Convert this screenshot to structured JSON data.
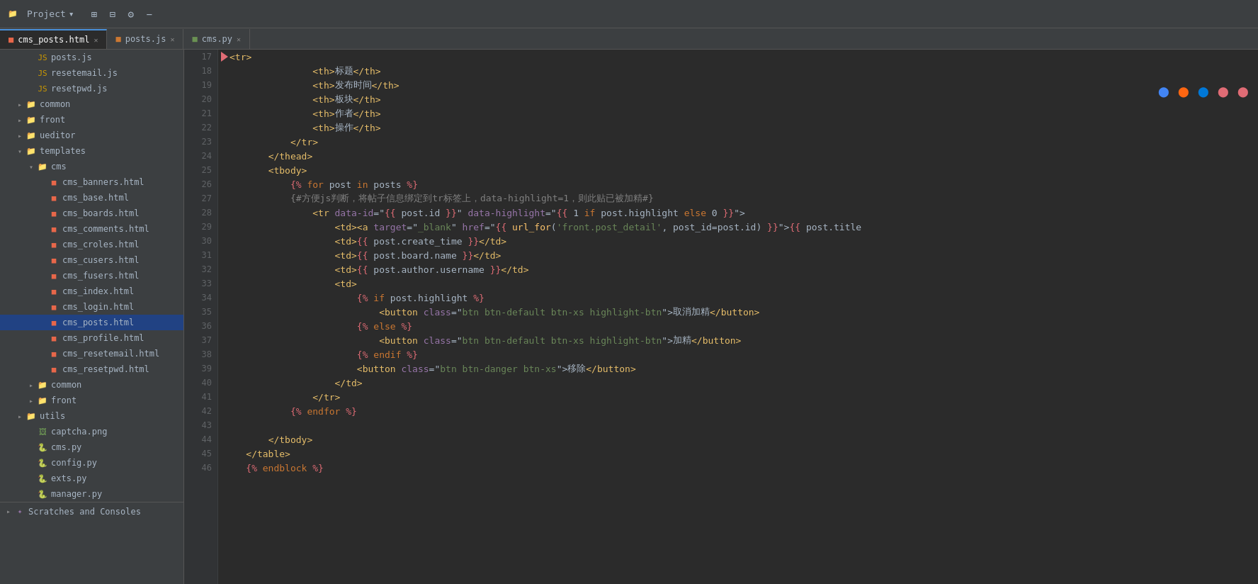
{
  "titleBar": {
    "projectLabel": "Project",
    "icons": [
      "settings-icon",
      "layout-icon",
      "gear-icon",
      "minus-icon"
    ]
  },
  "tabs": [
    {
      "id": "cms_posts",
      "label": "cms_posts.html",
      "type": "html",
      "active": true
    },
    {
      "id": "posts_js",
      "label": "posts.js",
      "type": "js",
      "active": false
    },
    {
      "id": "cms_py",
      "label": "cms.py",
      "type": "py",
      "active": false
    }
  ],
  "sidebar": {
    "files": [
      {
        "id": "posts_js_file",
        "label": "posts.js",
        "type": "js",
        "indent": 2
      },
      {
        "id": "resetemail_js",
        "label": "resetemail.js",
        "type": "js",
        "indent": 2
      },
      {
        "id": "resetpwd_js",
        "label": "resetpwd.js",
        "type": "js",
        "indent": 2
      },
      {
        "id": "common_folder",
        "label": "common",
        "type": "folder",
        "indent": 1,
        "open": false
      },
      {
        "id": "front_folder",
        "label": "front",
        "type": "folder",
        "indent": 1,
        "open": false
      },
      {
        "id": "ueditor_folder",
        "label": "ueditor",
        "type": "folder",
        "indent": 1,
        "open": false
      },
      {
        "id": "templates_folder",
        "label": "templates",
        "type": "folder",
        "indent": 1,
        "open": true
      },
      {
        "id": "cms_folder",
        "label": "cms",
        "type": "folder",
        "indent": 2,
        "open": true
      },
      {
        "id": "cms_banners",
        "label": "cms_banners.html",
        "type": "html",
        "indent": 3
      },
      {
        "id": "cms_base",
        "label": "cms_base.html",
        "type": "html",
        "indent": 3
      },
      {
        "id": "cms_boards",
        "label": "cms_boards.html",
        "type": "html",
        "indent": 3
      },
      {
        "id": "cms_comments",
        "label": "cms_comments.html",
        "type": "html",
        "indent": 3
      },
      {
        "id": "cms_croles",
        "label": "cms_croles.html",
        "type": "html",
        "indent": 3
      },
      {
        "id": "cms_cusers",
        "label": "cms_cusers.html",
        "type": "html",
        "indent": 3
      },
      {
        "id": "cms_fusers",
        "label": "cms_fusers.html",
        "type": "html",
        "indent": 3
      },
      {
        "id": "cms_index",
        "label": "cms_index.html",
        "type": "html",
        "indent": 3
      },
      {
        "id": "cms_login",
        "label": "cms_login.html",
        "type": "html",
        "indent": 3
      },
      {
        "id": "cms_posts_html",
        "label": "cms_posts.html",
        "type": "html",
        "indent": 3,
        "selected": true
      },
      {
        "id": "cms_profile",
        "label": "cms_profile.html",
        "type": "html",
        "indent": 3
      },
      {
        "id": "cms_resetemail",
        "label": "cms_resetemail.html",
        "type": "html",
        "indent": 3
      },
      {
        "id": "cms_resetpwd",
        "label": "cms_resetpwd.html",
        "type": "html",
        "indent": 3
      },
      {
        "id": "common_folder2",
        "label": "common",
        "type": "folder",
        "indent": 2,
        "open": false
      },
      {
        "id": "front_folder2",
        "label": "front",
        "type": "folder",
        "indent": 2,
        "open": false
      },
      {
        "id": "utils_folder",
        "label": "utils",
        "type": "folder",
        "indent": 1,
        "open": false
      },
      {
        "id": "captcha_png",
        "label": "captcha.png",
        "type": "png",
        "indent": 2
      },
      {
        "id": "cms_py_file",
        "label": "cms.py",
        "type": "py",
        "indent": 2
      },
      {
        "id": "config_py",
        "label": "config.py",
        "type": "py",
        "indent": 2
      },
      {
        "id": "exts_py",
        "label": "exts.py",
        "type": "py",
        "indent": 2
      },
      {
        "id": "manager_py",
        "label": "manager.py",
        "type": "py",
        "indent": 2
      }
    ],
    "scratchesLabel": "Scratches and Consoles"
  },
  "editor": {
    "filename": "cms_posts.html",
    "lines": [
      {
        "num": 17,
        "content": "            <tr>"
      },
      {
        "num": 18,
        "content": "                <th>标题</th>"
      },
      {
        "num": 19,
        "content": "                <th>发布时间</th>"
      },
      {
        "num": 20,
        "content": "                <th>板块</th>"
      },
      {
        "num": 21,
        "content": "                <th>作者</th>"
      },
      {
        "num": 22,
        "content": "                <th>操作</th>"
      },
      {
        "num": 23,
        "content": "            </tr>"
      },
      {
        "num": 24,
        "content": "        </thead>"
      },
      {
        "num": 25,
        "content": "        <tbody>"
      },
      {
        "num": 26,
        "content": "            {% for post in posts %}"
      },
      {
        "num": 27,
        "content": "            {#方便js判断，将帖子信息绑定到tr标签上，data-highlight=1，则此贴已被加精#}"
      },
      {
        "num": 28,
        "content": "                <tr data-id=\"{{ post.id }}\" data-highlight=\"{{ 1 if post.highlight else 0 }}\">"
      },
      {
        "num": 29,
        "content": "                    <td><a target=\"_blank\" href=\"{{ url_for('front.post_detail', post_id=post.id) }}\">{{ post.title"
      },
      {
        "num": 30,
        "content": "                    <td>{{ post.create_time }}</td>"
      },
      {
        "num": 31,
        "content": "                    <td>{{ post.board.name }}</td>"
      },
      {
        "num": 32,
        "content": "                    <td>{{ post.author.username }}</td>"
      },
      {
        "num": 33,
        "content": "                    <td>"
      },
      {
        "num": 34,
        "content": "                        {% if post.highlight %}"
      },
      {
        "num": 35,
        "content": "                            <button class=\"btn btn-default btn-xs highlight-btn\">取消加精</button>"
      },
      {
        "num": 36,
        "content": "                        {% else %}"
      },
      {
        "num": 37,
        "content": "                            <button class=\"btn btn-default btn-xs highlight-btn\">加精</button>"
      },
      {
        "num": 38,
        "content": "                        {% endif %}"
      },
      {
        "num": 39,
        "content": "                        <button class=\"btn btn-danger btn-xs\">移除</button>"
      },
      {
        "num": 40,
        "content": "                    </td>"
      },
      {
        "num": 41,
        "content": "                </tr>"
      },
      {
        "num": 42,
        "content": "            {% endfor %}"
      },
      {
        "num": 43,
        "content": ""
      },
      {
        "num": 44,
        "content": "        </tbody>"
      },
      {
        "num": 45,
        "content": "    </table>"
      },
      {
        "num": 46,
        "content": "    {% endblock %}"
      }
    ],
    "arrowLine": 17
  },
  "browserIcons": [
    "chrome",
    "firefox",
    "edge",
    "ie",
    "opera"
  ]
}
